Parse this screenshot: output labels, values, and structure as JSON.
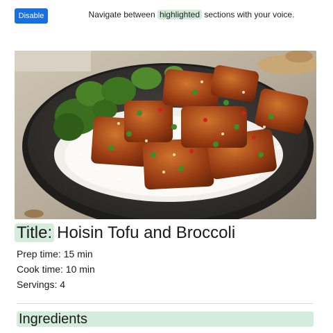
{
  "toolbar": {
    "disable_label": "Disable"
  },
  "voice_hint": {
    "before": "Navigate between",
    "highlight": "highlighted",
    "after": "sections with your voice."
  },
  "recipe": {
    "image_alt": "Hoisin tofu and broccoli over rice in a dark bowl",
    "title_label": "Title:",
    "title": "Hoisin Tofu and Broccoli",
    "prep_time": "Prep time: 15 min",
    "cook_time": "Cook time: 10 min",
    "servings": "Servings: 4",
    "section_heading": "Ingredients"
  },
  "colors": {
    "accent_button": "#1a6fe0",
    "highlight": "#d4ecdc"
  }
}
